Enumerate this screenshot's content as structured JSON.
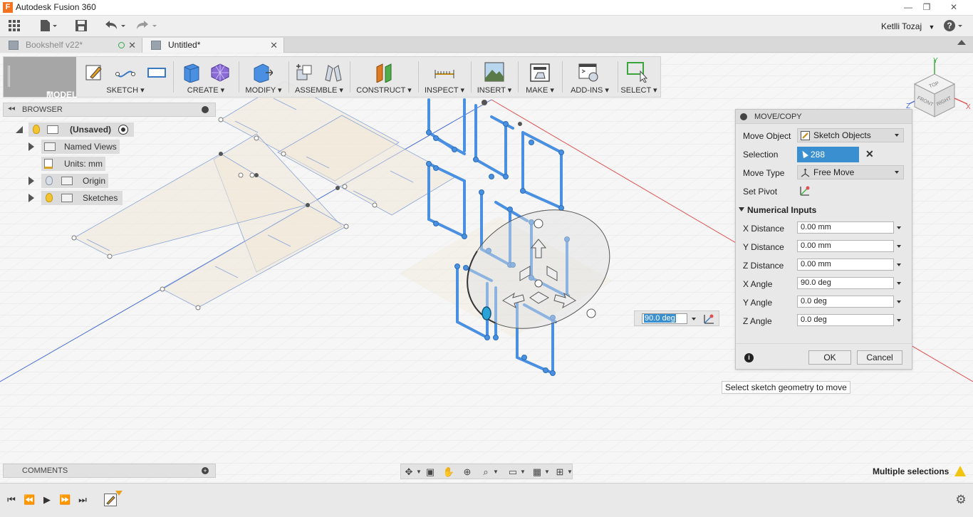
{
  "app": {
    "title": "Autodesk Fusion 360",
    "logo_letter": "F"
  },
  "window_controls": {
    "minimize": "—",
    "maximize": "❐",
    "close": "✕"
  },
  "quick_access": {
    "user": "Ketlli Tozaj"
  },
  "tabs": [
    {
      "label": "Bookshelf v22*",
      "active": false
    },
    {
      "label": "Untitled*",
      "active": true
    }
  ],
  "toolbar": {
    "workspace": "MODEL",
    "groups": [
      {
        "label": "SKETCH"
      },
      {
        "label": "CREATE"
      },
      {
        "label": "MODIFY"
      },
      {
        "label": "ASSEMBLE"
      },
      {
        "label": "CONSTRUCT"
      },
      {
        "label": "INSPECT"
      },
      {
        "label": "INSERT"
      },
      {
        "label": "MAKE"
      },
      {
        "label": "ADD-INS"
      },
      {
        "label": "SELECT"
      }
    ]
  },
  "browser": {
    "title": "BROWSER",
    "root": "(Unsaved)",
    "items": [
      {
        "label": "Named Views"
      },
      {
        "label": "Units: mm"
      },
      {
        "label": "Origin"
      },
      {
        "label": "Sketches"
      }
    ]
  },
  "comments": {
    "title": "COMMENTS"
  },
  "status": {
    "text": "Multiple selections"
  },
  "dialog": {
    "title": "MOVE/COPY",
    "move_object_label": "Move Object",
    "move_object_value": "Sketch Objects",
    "selection_label": "Selection",
    "selection_value": "288 selected",
    "move_type_label": "Move Type",
    "move_type_value": "Free Move",
    "set_pivot_label": "Set Pivot",
    "numerical_inputs": "Numerical Inputs",
    "fields": [
      {
        "label": "X Distance",
        "value": "0.00 mm"
      },
      {
        "label": "Y Distance",
        "value": "0.00 mm"
      },
      {
        "label": "Z Distance",
        "value": "0.00 mm"
      },
      {
        "label": "X Angle",
        "value": "90.0 deg"
      },
      {
        "label": "Y Angle",
        "value": "0.0 deg"
      },
      {
        "label": "Z Angle",
        "value": "0.0 deg"
      }
    ],
    "ok": "OK",
    "cancel": "Cancel"
  },
  "tooltip": "Select sketch geometry to move",
  "angle_input": "90.0 deg",
  "viewcube": {
    "top": "TOP",
    "front": "FRONT",
    "right": "RIGHT",
    "axis_y": "Y",
    "axis_x": "X",
    "axis_z": "Z"
  },
  "colors": {
    "accent": "#3a8fd0",
    "sketch_line": "#4a90e2",
    "workspace_bg": "#a6a6a6"
  }
}
